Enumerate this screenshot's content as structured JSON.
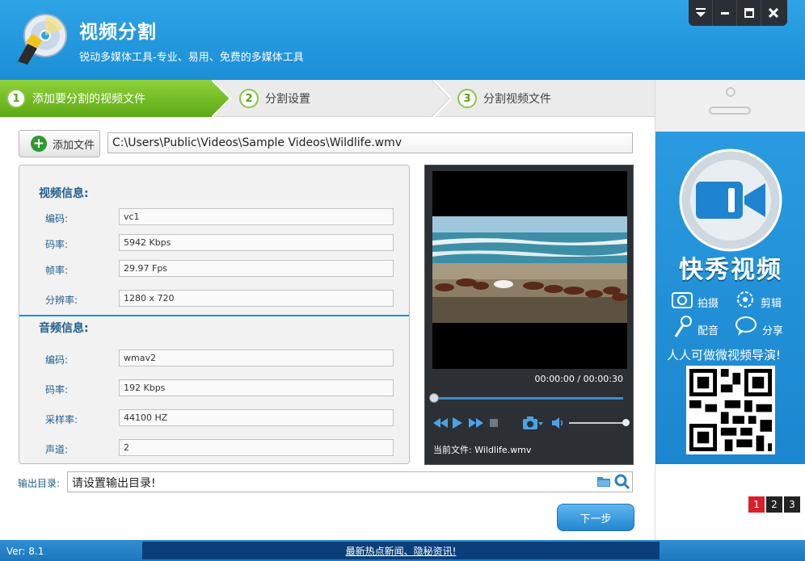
{
  "header": {
    "title": "视频分割",
    "subtitle": "锐动多媒体工具-专业、易用、免费的多媒体工具",
    "window_controls": [
      "menu-icon",
      "minimize-icon",
      "maximize-icon",
      "close-icon"
    ]
  },
  "steps": [
    {
      "num": "1",
      "label": "添加要分割的视频文件",
      "active": true
    },
    {
      "num": "2",
      "label": "分割设置",
      "active": false
    },
    {
      "num": "3",
      "label": "分割视频文件",
      "active": false
    }
  ],
  "add_file": {
    "button_label": "添加文件",
    "path": "C:\\Users\\Public\\Videos\\Sample Videos\\Wildlife.wmv"
  },
  "video_info": {
    "title": "视频信息:",
    "rows": [
      {
        "label": "编码:",
        "value": "vc1"
      },
      {
        "label": "码率:",
        "value": "5942 Kbps"
      },
      {
        "label": "帧率:",
        "value": "29.97 Fps"
      },
      {
        "label": "分辨率:",
        "value": "1280 x 720"
      }
    ]
  },
  "audio_info": {
    "title": "音频信息:",
    "rows": [
      {
        "label": "编码:",
        "value": "wmav2"
      },
      {
        "label": "码率:",
        "value": "192 Kbps"
      },
      {
        "label": "采样率:",
        "value": "44100 HZ"
      },
      {
        "label": "声道:",
        "value": "2"
      }
    ]
  },
  "player": {
    "timecode": "00:00:00 / 00:00:30",
    "progress": 0,
    "volume": 1.0,
    "current_file": "当前文件: Wildlife.wmv"
  },
  "output": {
    "label": "输出目录:",
    "value": "请设置输出目录!"
  },
  "next_button": "下一步",
  "footer": {
    "version": "Ver: 8.1",
    "news": "最新热点新闻、隐秘资讯!"
  },
  "ad": {
    "brand": "快秀视频",
    "features": [
      "拍摄",
      "剪辑",
      "配音",
      "分享"
    ],
    "slogan": "人人可做微视频导演!",
    "pages": [
      "1",
      "2",
      "3"
    ],
    "active_page": "1"
  },
  "colors": {
    "header_blue": "#1b8fd6",
    "step_active_green": "#5da814",
    "label_blue": "#1f5e8f",
    "player_bg": "#2c2f33"
  }
}
